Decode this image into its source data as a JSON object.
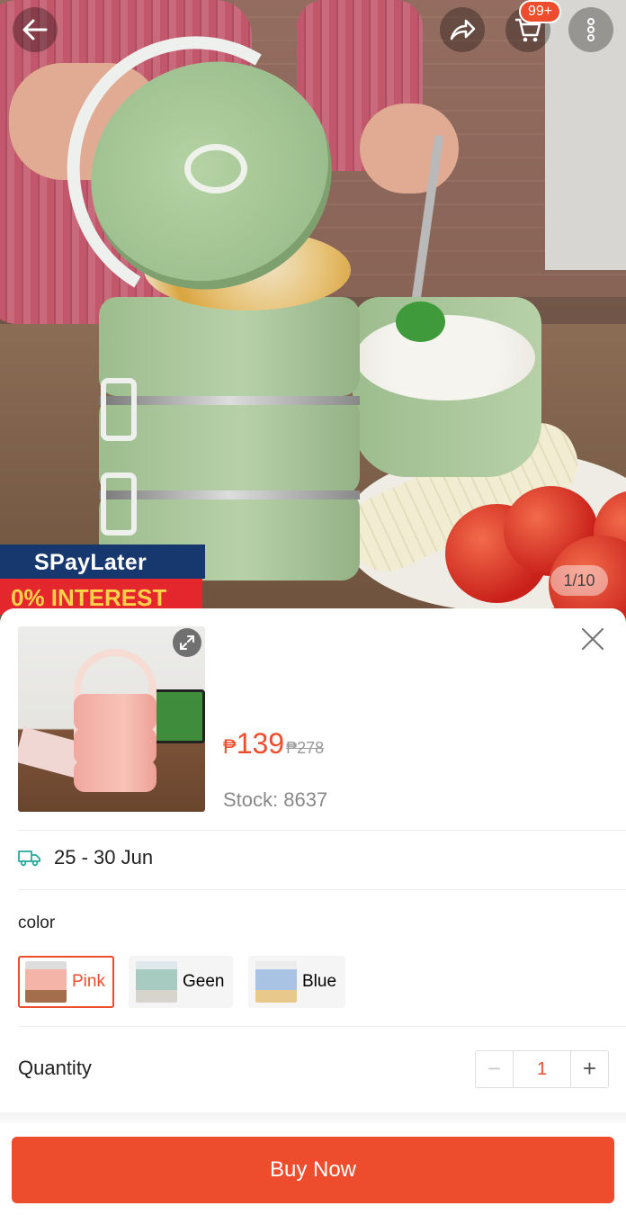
{
  "header": {
    "cart_badge": "99+",
    "image_counter": "1/10",
    "icons": [
      "back-arrow-icon",
      "share-icon",
      "cart-icon",
      "more-icon"
    ]
  },
  "promo": {
    "line1": "SPayLater",
    "line2": "0% INTEREST"
  },
  "product": {
    "currency": "₱",
    "price": "139",
    "original_price": "₱278",
    "stock": "Stock: 8637"
  },
  "shipping": {
    "icon": "truck-icon",
    "date_range": "25 - 30 Jun"
  },
  "variants": {
    "label": "color",
    "options": [
      {
        "label": "Pink",
        "selected": true
      },
      {
        "label": "Geen",
        "selected": false
      },
      {
        "label": "Blue",
        "selected": false
      }
    ]
  },
  "quantity": {
    "label": "Quantity",
    "value": "1",
    "minus": "−",
    "plus": "+"
  },
  "actions": {
    "buy_now": "Buy Now"
  },
  "colors": {
    "accent": "#ee4d2d",
    "promo_navy": "#17386e",
    "promo_red": "#e4272d",
    "promo_yellow": "#ffd24a"
  }
}
